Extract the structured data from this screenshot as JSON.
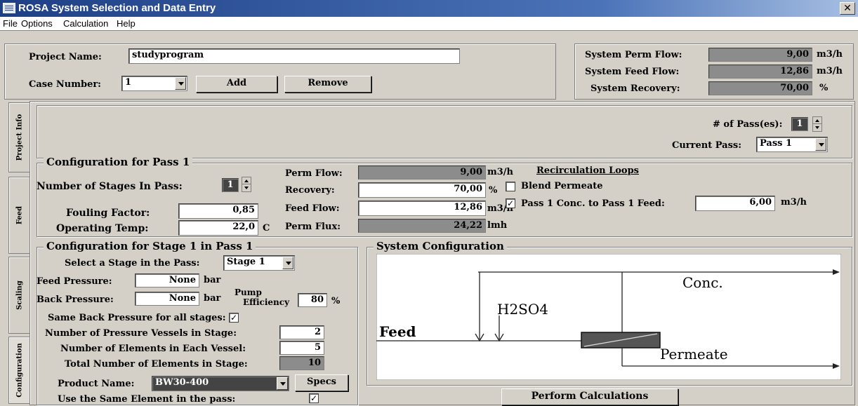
{
  "window": {
    "title": "ROSA System Selection and Data Entry",
    "close_glyph": "✕"
  },
  "menu": [
    "File",
    "Options",
    "Calculation",
    "Help"
  ],
  "project": {
    "name_label": "Project Name:",
    "name_value": "studyprogram",
    "case_label": "Case Number:",
    "case_value": "1",
    "add_label": "Add",
    "remove_label": "Remove"
  },
  "system_summary": {
    "perm_flow": {
      "label": "System Perm Flow:",
      "value": "9,00",
      "unit": "m3/h"
    },
    "feed_flow": {
      "label": "System Feed Flow:",
      "value": "12,86",
      "unit": "m3/h"
    },
    "recovery": {
      "label": "System Recovery:",
      "value": "70,00",
      "unit": "%"
    }
  },
  "side_tabs": [
    "Project Info",
    "Feed",
    "Scaling",
    "Configuration"
  ],
  "passes": {
    "count_label": "# of Pass(es):",
    "count_value": "1",
    "current_label": "Current Pass:",
    "current_value": "Pass 1"
  },
  "pass_config": {
    "title": "Configuration for Pass 1",
    "stages_label": "Number of Stages In Pass:",
    "stages_value": "1",
    "fouling_label": "Fouling Factor:",
    "fouling_value": "0,85",
    "temp_label": "Operating Temp:",
    "temp_value": "22,0",
    "temp_unit": "C",
    "perm_flow_label": "Perm Flow:",
    "perm_flow_value": "9,00",
    "perm_flow_unit": "m3/h",
    "recovery_label": "Recovery:",
    "recovery_value": "70,00",
    "recovery_unit": "%",
    "feed_flow_label": "Feed Flow:",
    "feed_flow_value": "12,86",
    "feed_flow_unit": "m3/h",
    "perm_flux_label": "Perm Flux:",
    "perm_flux_value": "24,22",
    "perm_flux_unit": "lmh",
    "recirc_title": "Recirculation Loops",
    "blend_label": "Blend Permeate",
    "blend_checked": false,
    "conc_label": "Pass 1 Conc. to Pass 1 Feed:",
    "conc_checked": true,
    "conc_value": "6,00",
    "conc_unit": "m3/h"
  },
  "stage_config": {
    "title": "Configuration for Stage 1 in Pass 1",
    "select_label": "Select a Stage in the Pass:",
    "select_value": "Stage 1",
    "feed_pressure_label": "Feed Pressure:",
    "feed_pressure_value": "None",
    "feed_pressure_unit": "bar",
    "back_pressure_label": "Back Pressure:",
    "back_pressure_value": "None",
    "back_pressure_unit": "bar",
    "pump_eff_label_1": "Pump",
    "pump_eff_label_2": "Efficiency",
    "pump_eff_value": "80",
    "pump_eff_unit": "%",
    "same_back_label": "Same Back Pressure for all stages:",
    "same_back_checked": true,
    "vessels_label": "Number of Pressure Vessels in Stage:",
    "vessels_value": "2",
    "elements_label": "Number of Elements in Each Vessel:",
    "elements_value": "5",
    "total_label": "Total Number of Elements in Stage:",
    "total_value": "10",
    "product_label": "Product Name:",
    "product_value": "BW30-400",
    "specs_label": "Specs",
    "same_element_label": "Use the Same Element in the pass:",
    "same_element_checked": true
  },
  "system_config": {
    "title": "System Configuration",
    "conc_label": "Conc.",
    "acid_label": "H2SO4",
    "feed_label": "Feed",
    "permeate_label": "Permeate"
  },
  "perform_label": "Perform Calculations",
  "check_glyph": "✓"
}
